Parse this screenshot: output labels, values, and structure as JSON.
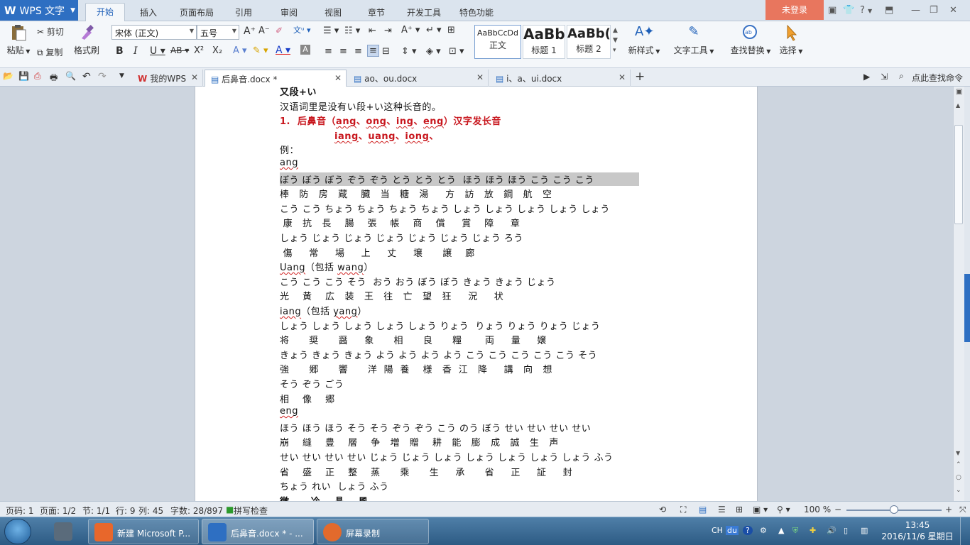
{
  "app": {
    "name": "WPS 文字"
  },
  "menu": {
    "tabs": [
      "开始",
      "插入",
      "页面布局",
      "引用",
      "审阅",
      "视图",
      "章节",
      "开发工具",
      "特色功能"
    ],
    "login": "未登录",
    "help": "?"
  },
  "ribbon": {
    "paste": "粘贴",
    "cut": "剪切",
    "copy": "复制",
    "format_painter": "格式刷",
    "font_name": "宋体 (正文)",
    "font_size": "五号",
    "styles": [
      {
        "sample": "AaBbCcDd",
        "label": "正文"
      },
      {
        "sample": "AaBb",
        "label": "标题 1"
      },
      {
        "sample": "AaBb(",
        "label": "标题 2"
      }
    ],
    "new_style": "新样式",
    "text_tools": "文字工具",
    "find_replace": "查找替换",
    "select": "选择"
  },
  "doc_tabs": [
    {
      "label": "我的WPS",
      "active": false
    },
    {
      "label": "后鼻音.docx *",
      "active": true
    },
    {
      "label": "ao、ou.docx",
      "active": false
    },
    {
      "label": "i、a、ui.docx",
      "active": false
    }
  ],
  "search_command": "点此查找命令",
  "document": {
    "lines": [
      {
        "text": "又段+い",
        "style": "cut"
      },
      {
        "text": "汉语词里是没有い段+い这种长音的。",
        "style": "normal"
      },
      {
        "text": "1.  后鼻音（ang、ong、ing、eng）汉字发长音",
        "style": "red"
      },
      {
        "text": "iang、uang、iong、",
        "style": "red-indent"
      },
      {
        "text": "例：",
        "style": "normal"
      },
      {
        "text": "ang",
        "style": "normal"
      },
      {
        "text": "ぼう ぼう ぼう ぞう ぞう とう とう とう  ほう ほう ほう こう こう こう",
        "style": "hl"
      },
      {
        "text": "棒   防   房   蔵    臓   当   糖   湯     方   訪   放   鋼   航   空",
        "style": "normal"
      },
      {
        "text": "こう こう ちょう ちょう ちょう ちょう しょう しょう しょう しょう しょう",
        "style": "normal"
      },
      {
        "text": " 康   抗   長    腸    張    帳    商    償     賞    障     章",
        "style": "normal"
      },
      {
        "text": "しょう じょう じょう じょう じょう じょう じょう ろう",
        "style": "normal"
      },
      {
        "text": " 傷     常     場     上     丈     壌      譲    廊",
        "style": "normal"
      },
      {
        "text": "Uang（包括 wang）",
        "style": "normal"
      },
      {
        "text": "こう こう こう そう  おう おう ぼう ぼう きょう きょう じょう",
        "style": "normal"
      },
      {
        "text": "光    黄    広   装   王   往   亡   望   狂     況     状",
        "style": "normal"
      },
      {
        "text": "iang（包括 yang）",
        "style": "normal"
      },
      {
        "text": "しょう しょう しょう しょう しょう りょう  りょう りょう りょう じょう",
        "style": "normal"
      },
      {
        "text": "将      奨      醤     象      相      良      糧       両     量     嬢",
        "style": "normal"
      },
      {
        "text": "きょう きょう きょう よう よう よう よう こう こう こう こう こう そう",
        "style": "normal"
      },
      {
        "text": "強      郷      響      洋  陽  養    様   香  江   降     講   向   想",
        "style": "normal"
      },
      {
        "text": "そう ぞう ごう",
        "style": "normal"
      },
      {
        "text": "相    像    郷",
        "style": "normal"
      },
      {
        "text": "eng",
        "style": "normal"
      },
      {
        "text": "ほう ほう ほう そう そう ぞう ぞう こう のう ぼう せい せい せい せい",
        "style": "normal"
      },
      {
        "text": "崩    縫    豊    層    争   増   贈    耕   能   膨   成   誠   生   声",
        "style": "normal"
      },
      {
        "text": "せい せい せい せい じょう じょう しょう しょう しょう しょう しょう ふう",
        "style": "normal"
      },
      {
        "text": "省    盛    正    整    蒸      乘      生     承      省     正     証     封",
        "style": "normal"
      },
      {
        "text": "ちょう れい  しょう ふう",
        "style": "normal"
      },
      {
        "text": "徴      冷    晶    風",
        "style": "cut"
      }
    ]
  },
  "status": {
    "page_no": "页码: 1",
    "pages": "页面: 1/2",
    "section": "节: 1/1",
    "row": "行: 9",
    "col": "列: 45",
    "words": "字数: 28/897",
    "spell": "拼写检查",
    "zoom": "100 %",
    "zoom_level": 0.5
  },
  "taskbar": {
    "apps": [
      {
        "label": "新建 Microsoft P...",
        "color": "#e8672b"
      },
      {
        "label": "后鼻音.docx * - ...",
        "color": "#2e6fc2"
      },
      {
        "label": "屏幕录制",
        "color": "#e26a2c"
      }
    ],
    "lang": "CH",
    "time": "13:45",
    "date": "2016/11/6 星期日"
  }
}
